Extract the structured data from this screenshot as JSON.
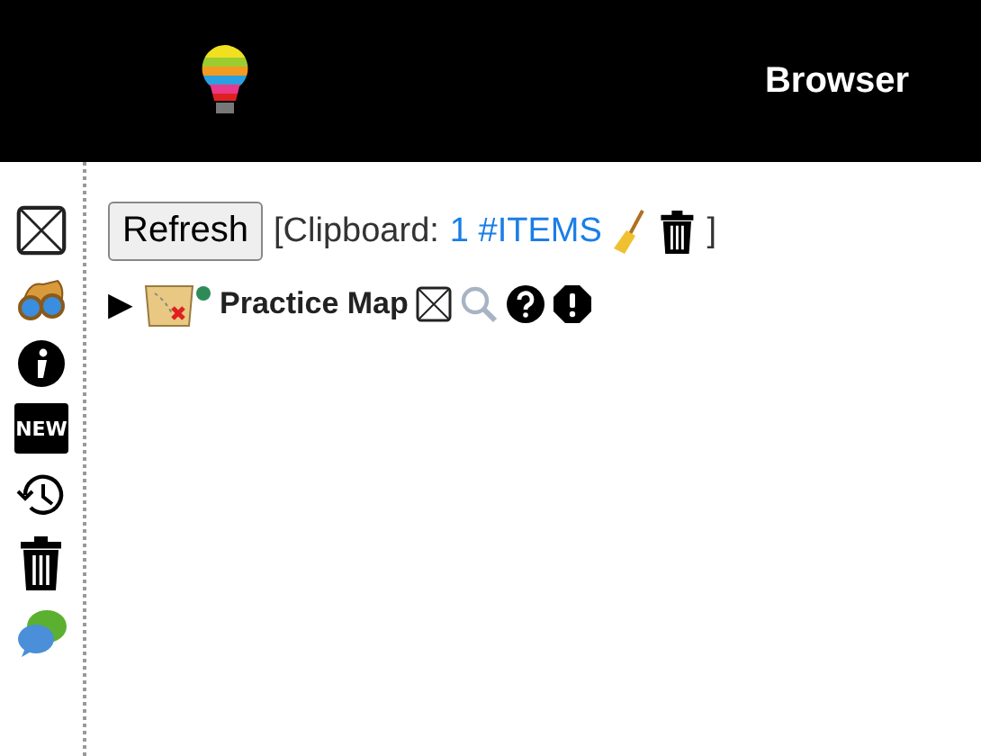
{
  "header": {
    "title": "Browser"
  },
  "sidebar": {
    "items": [
      {
        "kind": "close"
      },
      {
        "kind": "binoculars"
      },
      {
        "kind": "info"
      },
      {
        "kind": "new",
        "label": "NEW"
      },
      {
        "kind": "history"
      },
      {
        "kind": "trash"
      },
      {
        "kind": "chat"
      }
    ]
  },
  "toolbar": {
    "refresh": "Refresh",
    "clipboard_prefix": "[Clipboard:",
    "clipboard_link": "1 #ITEMS",
    "clipboard_suffix": "]"
  },
  "tree": [
    {
      "toggle": "▶",
      "expanded": false,
      "title": "Practice Map"
    }
  ]
}
